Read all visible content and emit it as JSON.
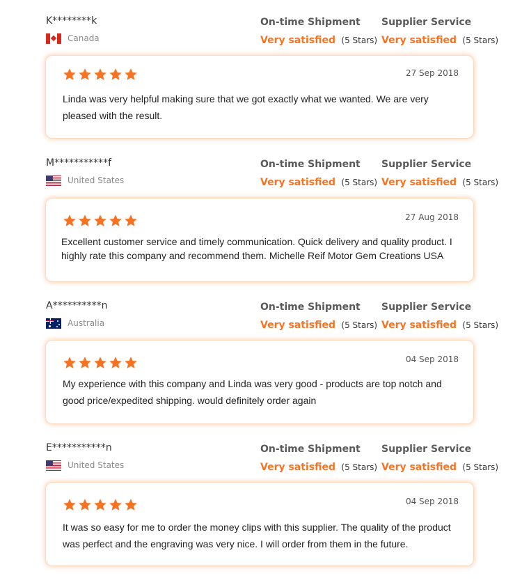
{
  "metric_labels": {
    "shipment": "On-time Shipment",
    "service": "Supplier Service"
  },
  "colors": {
    "accent": "#f57322",
    "card_border": "#ffd7bd"
  },
  "reviews": [
    {
      "user": "K********k",
      "country": "Canada",
      "flag": "canada-flag-icon",
      "shipment_rating": "Very satisfied",
      "shipment_stars": "(5 Stars)",
      "service_rating": "Very satisfied",
      "service_stars": "(5 Stars)",
      "star_count": 5,
      "date": "27 Sep 2018",
      "text": "Linda was very helpful making sure that we got exactly what we wanted. We are very pleased with the result."
    },
    {
      "user": "M***********f",
      "country": "United States",
      "flag": "usa-flag-icon",
      "shipment_rating": "Very satisfied",
      "shipment_stars": "(5 Stars)",
      "service_rating": "Very satisfied",
      "service_stars": "(5 Stars)",
      "star_count": 5,
      "date": "27 Aug 2018",
      "text": "Excellent customer service and timely communication. Quick delivery and quality product. I highly rate this company and recommend them. Michelle Reif Motor Gem Creations USA"
    },
    {
      "user": "A**********n",
      "country": "Australia",
      "flag": "australia-flag-icon",
      "shipment_rating": "Very satisfied",
      "shipment_stars": "(5 Stars)",
      "service_rating": "Very satisfied",
      "service_stars": "(5 Stars)",
      "star_count": 5,
      "date": "04 Sep 2018",
      "text": "My experience with this company and Linda was very good - products are top notch and good price/expedited shipping. would definitely order again"
    },
    {
      "user": "E***********n",
      "country": "United States",
      "flag": "usa-flag-icon",
      "shipment_rating": "Very satisfied",
      "shipment_stars": "(5 Stars)",
      "service_rating": "Very satisfied",
      "service_stars": "(5 Stars)",
      "star_count": 5,
      "date": "04 Sep 2018",
      "text": "It was so easy for me to order the money clips with this supplier. The quality of the product was perfect and the engraving was very nice. I will order from them in the future."
    }
  ]
}
